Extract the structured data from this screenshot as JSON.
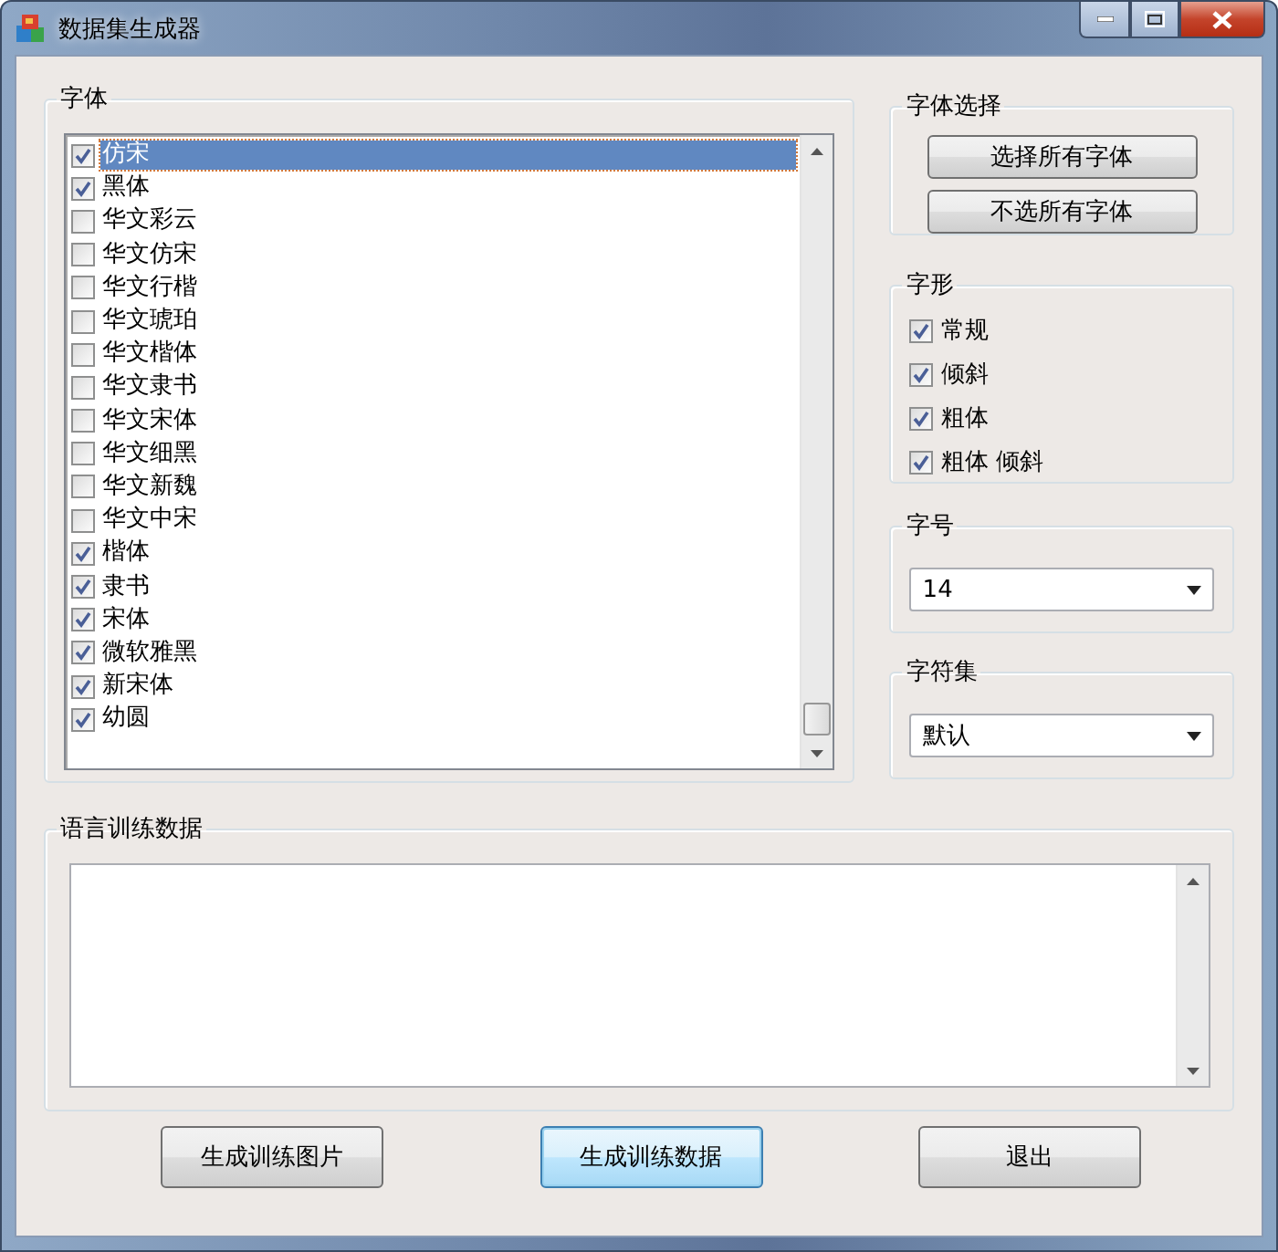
{
  "window": {
    "title": "数据集生成器"
  },
  "font_group": {
    "title": "字体",
    "items": [
      {
        "label": "仿宋",
        "checked": true,
        "selected": true
      },
      {
        "label": "黑体",
        "checked": true,
        "selected": false
      },
      {
        "label": "华文彩云",
        "checked": false,
        "selected": false
      },
      {
        "label": "华文仿宋",
        "checked": false,
        "selected": false
      },
      {
        "label": "华文行楷",
        "checked": false,
        "selected": false
      },
      {
        "label": "华文琥珀",
        "checked": false,
        "selected": false
      },
      {
        "label": "华文楷体",
        "checked": false,
        "selected": false
      },
      {
        "label": "华文隶书",
        "checked": false,
        "selected": false
      },
      {
        "label": "华文宋体",
        "checked": false,
        "selected": false
      },
      {
        "label": "华文细黑",
        "checked": false,
        "selected": false
      },
      {
        "label": "华文新魏",
        "checked": false,
        "selected": false
      },
      {
        "label": "华文中宋",
        "checked": false,
        "selected": false
      },
      {
        "label": "楷体",
        "checked": true,
        "selected": false
      },
      {
        "label": "隶书",
        "checked": true,
        "selected": false
      },
      {
        "label": "宋体",
        "checked": true,
        "selected": false
      },
      {
        "label": "微软雅黑",
        "checked": true,
        "selected": false
      },
      {
        "label": "新宋体",
        "checked": true,
        "selected": false
      },
      {
        "label": "幼圆",
        "checked": true,
        "selected": false
      }
    ]
  },
  "font_select": {
    "title": "字体选择",
    "buttons": [
      "选择所有字体",
      "不选所有字体"
    ]
  },
  "style_group": {
    "title": "字形",
    "options": [
      {
        "label": "常规",
        "checked": true
      },
      {
        "label": "倾斜",
        "checked": true
      },
      {
        "label": "粗体",
        "checked": true
      },
      {
        "label": "粗体 倾斜",
        "checked": true
      }
    ]
  },
  "size_group": {
    "title": "字号",
    "value": "14"
  },
  "charset_group": {
    "title": "字符集",
    "value": "默认"
  },
  "training_data": {
    "title": "语言训练数据"
  },
  "buttons": [
    {
      "label": "生成训练图片",
      "focused": false
    },
    {
      "label": "生成训练数据",
      "focused": true
    },
    {
      "label": "退出",
      "focused": false
    }
  ]
}
